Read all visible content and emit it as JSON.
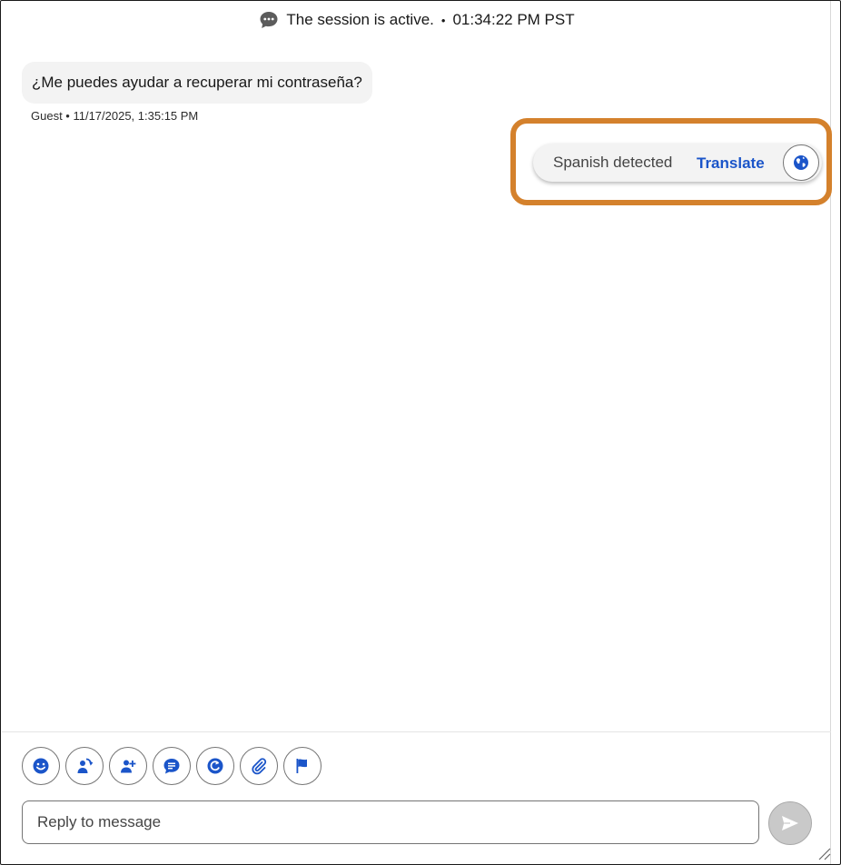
{
  "session": {
    "status_text": "The session is active.",
    "separator": "•",
    "time": "01:34:22 PM PST",
    "icon": "chat-bubble-icon"
  },
  "messages": [
    {
      "text": "¿Me puedes ayudar a recuperar mi contraseña?",
      "meta": "Guest • 11/17/2025, 1:35:15 PM"
    }
  ],
  "translation": {
    "detected_label": "Spanish detected",
    "action_label": "Translate",
    "icon": "globe-icon",
    "highlight_color": "#d4812c"
  },
  "toolbar": {
    "buttons": [
      {
        "icon": "emoji-icon"
      },
      {
        "icon": "transfer-agent-icon"
      },
      {
        "icon": "add-participant-icon"
      },
      {
        "icon": "quick-text-icon"
      },
      {
        "icon": "knowledge-icon"
      },
      {
        "icon": "attach-file-icon"
      },
      {
        "icon": "flag-icon"
      }
    ]
  },
  "composer": {
    "placeholder": "Reply to message",
    "send_icon": "send-icon"
  },
  "colors": {
    "accent": "#1b55c9",
    "bubble": "#f3f3f3",
    "send_disabled": "#c9c9c9"
  }
}
